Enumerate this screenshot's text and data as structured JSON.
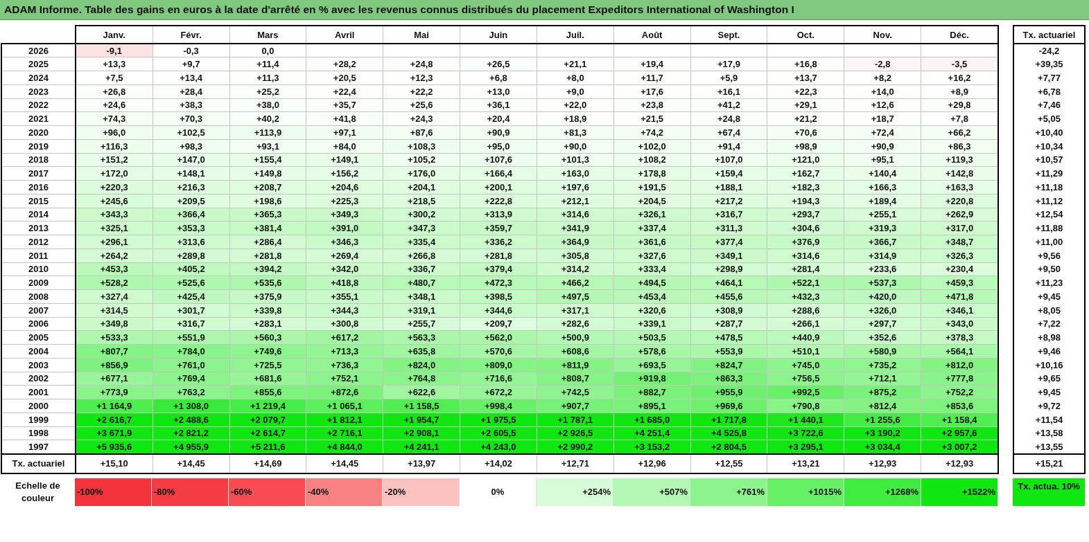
{
  "title": "ADAM Informe. Table des gains en euros à la date d'arrêté en % avec les revenus connus distribués du placement Expeditors International of Washington I",
  "columns": [
    "Janv.",
    "Févr.",
    "Mars",
    "Avril",
    "Mai",
    "Juin",
    "Juil.",
    "Août",
    "Sept.",
    "Oct.",
    "Nov.",
    "Déc."
  ],
  "rate_header": "Tx. actuariel",
  "rows": [
    {
      "year": "2026",
      "cells": [
        "-9,1",
        "-0,3",
        "0,0"
      ],
      "rate": "-24,2"
    },
    {
      "year": "2025",
      "cells": [
        "+13,3",
        "+9,7",
        "+11,4",
        "+28,2",
        "+24,8",
        "+26,5",
        "+21,1",
        "+19,4",
        "+17,9",
        "+16,8",
        "-2,8",
        "-3,5"
      ],
      "rate": "+39,35"
    },
    {
      "year": "2024",
      "cells": [
        "+7,5",
        "+13,4",
        "+11,3",
        "+20,5",
        "+12,3",
        "+6,8",
        "+8,0",
        "+11,7",
        "+5,9",
        "+13,7",
        "+8,2",
        "+16,2"
      ],
      "rate": "+7,77"
    },
    {
      "year": "2023",
      "cells": [
        "+26,8",
        "+28,4",
        "+25,2",
        "+22,4",
        "+22,2",
        "+13,0",
        "+9,0",
        "+17,6",
        "+16,1",
        "+22,3",
        "+14,0",
        "+8,9"
      ],
      "rate": "+6,78"
    },
    {
      "year": "2022",
      "cells": [
        "+24,6",
        "+38,3",
        "+38,0",
        "+35,7",
        "+25,6",
        "+36,1",
        "+22,0",
        "+23,8",
        "+41,2",
        "+29,1",
        "+12,6",
        "+29,8"
      ],
      "rate": "+7,46"
    },
    {
      "year": "2021",
      "cells": [
        "+74,3",
        "+70,3",
        "+40,2",
        "+41,8",
        "+24,3",
        "+20,4",
        "+18,9",
        "+21,5",
        "+24,8",
        "+21,2",
        "+18,7",
        "+7,8"
      ],
      "rate": "+5,05"
    },
    {
      "year": "2020",
      "cells": [
        "+96,0",
        "+102,5",
        "+113,9",
        "+97,1",
        "+87,6",
        "+90,9",
        "+81,3",
        "+74,2",
        "+67,4",
        "+70,6",
        "+72,4",
        "+66,2"
      ],
      "rate": "+10,40"
    },
    {
      "year": "2019",
      "cells": [
        "+116,3",
        "+98,3",
        "+93,1",
        "+84,0",
        "+108,3",
        "+95,0",
        "+90,0",
        "+102,0",
        "+91,4",
        "+98,9",
        "+90,9",
        "+86,3"
      ],
      "rate": "+10,34"
    },
    {
      "year": "2018",
      "cells": [
        "+151,2",
        "+147,0",
        "+155,4",
        "+149,1",
        "+105,2",
        "+107,6",
        "+101,3",
        "+108,2",
        "+107,0",
        "+121,0",
        "+95,1",
        "+119,3"
      ],
      "rate": "+10,57"
    },
    {
      "year": "2017",
      "cells": [
        "+172,0",
        "+148,1",
        "+149,8",
        "+156,2",
        "+176,0",
        "+166,4",
        "+163,0",
        "+178,8",
        "+159,4",
        "+162,7",
        "+140,4",
        "+142,8"
      ],
      "rate": "+11,29"
    },
    {
      "year": "2016",
      "cells": [
        "+220,3",
        "+216,3",
        "+208,7",
        "+204,6",
        "+204,1",
        "+200,1",
        "+197,6",
        "+191,5",
        "+188,1",
        "+182,3",
        "+166,3",
        "+163,3"
      ],
      "rate": "+11,18"
    },
    {
      "year": "2015",
      "cells": [
        "+245,6",
        "+209,5",
        "+198,6",
        "+225,3",
        "+218,5",
        "+222,8",
        "+212,1",
        "+204,5",
        "+217,2",
        "+194,3",
        "+189,4",
        "+220,8"
      ],
      "rate": "+11,12"
    },
    {
      "year": "2014",
      "cells": [
        "+343,3",
        "+366,4",
        "+365,3",
        "+349,3",
        "+300,2",
        "+313,9",
        "+314,6",
        "+326,1",
        "+316,7",
        "+293,7",
        "+255,1",
        "+262,9"
      ],
      "rate": "+12,54"
    },
    {
      "year": "2013",
      "cells": [
        "+325,1",
        "+353,3",
        "+381,4",
        "+391,0",
        "+347,3",
        "+359,7",
        "+341,9",
        "+337,4",
        "+311,3",
        "+304,6",
        "+319,3",
        "+317,0"
      ],
      "rate": "+11,88"
    },
    {
      "year": "2012",
      "cells": [
        "+296,1",
        "+313,6",
        "+286,4",
        "+346,3",
        "+335,4",
        "+336,2",
        "+364,9",
        "+361,6",
        "+377,4",
        "+376,9",
        "+366,7",
        "+348,7"
      ],
      "rate": "+11,00"
    },
    {
      "year": "2011",
      "cells": [
        "+264,2",
        "+289,8",
        "+281,8",
        "+269,4",
        "+266,8",
        "+281,8",
        "+305,8",
        "+327,6",
        "+349,1",
        "+314,6",
        "+314,9",
        "+326,3"
      ],
      "rate": "+9,56"
    },
    {
      "year": "2010",
      "cells": [
        "+453,3",
        "+405,2",
        "+394,2",
        "+342,0",
        "+336,7",
        "+379,4",
        "+314,2",
        "+333,4",
        "+298,9",
        "+281,4",
        "+233,6",
        "+230,4"
      ],
      "rate": "+9,50"
    },
    {
      "year": "2009",
      "cells": [
        "+528,2",
        "+525,6",
        "+535,6",
        "+418,8",
        "+480,7",
        "+472,3",
        "+466,2",
        "+494,5",
        "+464,1",
        "+522,1",
        "+537,3",
        "+459,3"
      ],
      "rate": "+11,23"
    },
    {
      "year": "2008",
      "cells": [
        "+327,4",
        "+425,4",
        "+375,9",
        "+355,1",
        "+348,1",
        "+398,5",
        "+497,5",
        "+453,4",
        "+455,6",
        "+432,3",
        "+420,0",
        "+471,8"
      ],
      "rate": "+9,45"
    },
    {
      "year": "2007",
      "cells": [
        "+314,5",
        "+301,7",
        "+339,8",
        "+344,3",
        "+319,1",
        "+344,6",
        "+317,1",
        "+320,6",
        "+308,9",
        "+288,6",
        "+326,0",
        "+346,1"
      ],
      "rate": "+8,05"
    },
    {
      "year": "2006",
      "cells": [
        "+349,8",
        "+316,7",
        "+283,1",
        "+300,8",
        "+255,7",
        "+209,7",
        "+282,6",
        "+339,1",
        "+287,7",
        "+266,1",
        "+297,7",
        "+343,0"
      ],
      "rate": "+7,22"
    },
    {
      "year": "2005",
      "cells": [
        "+533,3",
        "+551,9",
        "+560,3",
        "+617,2",
        "+563,3",
        "+562,0",
        "+500,9",
        "+503,5",
        "+478,5",
        "+440,9",
        "+352,6",
        "+378,3"
      ],
      "rate": "+8,98"
    },
    {
      "year": "2004",
      "cells": [
        "+807,7",
        "+784,0",
        "+749,6",
        "+713,3",
        "+635,8",
        "+570,6",
        "+608,6",
        "+578,6",
        "+553,9",
        "+510,1",
        "+580,9",
        "+564,1"
      ],
      "rate": "+9,46"
    },
    {
      "year": "2003",
      "cells": [
        "+856,9",
        "+761,0",
        "+725,5",
        "+736,3",
        "+824,0",
        "+809,0",
        "+811,9",
        "+693,5",
        "+824,7",
        "+745,0",
        "+735,2",
        "+812,0"
      ],
      "rate": "+10,16"
    },
    {
      "year": "2002",
      "cells": [
        "+677,1",
        "+769,4",
        "+681,6",
        "+752,1",
        "+764,8",
        "+716,6",
        "+808,7",
        "+919,8",
        "+863,3",
        "+756,5",
        "+712,1",
        "+777,8"
      ],
      "rate": "+9,65"
    },
    {
      "year": "2001",
      "cells": [
        "+773,9",
        "+763,2",
        "+855,6",
        "+872,6",
        "+622,6",
        "+672,2",
        "+742,5",
        "+882,7",
        "+955,9",
        "+992,5",
        "+875,2",
        "+752,2"
      ],
      "rate": "+9,45"
    },
    {
      "year": "2000",
      "cells": [
        "+1 164,9",
        "+1 308,0",
        "+1 219,4",
        "+1 065,1",
        "+1 158,5",
        "+998,4",
        "+907,7",
        "+895,1",
        "+969,6",
        "+790,8",
        "+812,4",
        "+853,6"
      ],
      "rate": "+9,72"
    },
    {
      "year": "1999",
      "cells": [
        "+2 616,7",
        "+2 488,6",
        "+2 079,7",
        "+1 812,1",
        "+1 954,7",
        "+1 975,5",
        "+1 787,1",
        "+1 685,0",
        "+1 717,8",
        "+1 440,1",
        "+1 255,6",
        "+1 158,4"
      ],
      "rate": "+11,54"
    },
    {
      "year": "1998",
      "cells": [
        "+3 671,9",
        "+2 821,2",
        "+2 614,7",
        "+2 716,1",
        "+2 908,1",
        "+2 605,5",
        "+2 926,5",
        "+4 251,4",
        "+4 525,8",
        "+3 722,6",
        "+3 190,2",
        "+2 957,6"
      ],
      "rate": "+13,58"
    },
    {
      "year": "1997",
      "cells": [
        "+5 935,6",
        "+4 955,9",
        "+5 211,6",
        "+4 844,0",
        "+4 241,1",
        "+4 243,0",
        "+2 990,2",
        "+3 153,2",
        "+2 804,5",
        "+3 295,1",
        "+3 034,4",
        "+3 007,2"
      ],
      "rate": "+13,55"
    }
  ],
  "footer": {
    "label": "Tx. actuariel",
    "cells": [
      "+15,10",
      "+14,45",
      "+14,69",
      "+14,45",
      "+13,97",
      "+14,02",
      "+12,71",
      "+12,96",
      "+12,55",
      "+13,21",
      "+12,93",
      "+12,93"
    ],
    "rate": "+15,21"
  },
  "legend": {
    "label": "Echelle de couleur",
    "items": [
      {
        "label": "-100%",
        "color": "#f4343c"
      },
      {
        "label": "-80%",
        "color": "#f53c44"
      },
      {
        "label": "-60%",
        "color": "#f64c52"
      },
      {
        "label": "-40%",
        "color": "#f88282"
      },
      {
        "label": "-20%",
        "color": "#fbc0c0"
      },
      {
        "label": "0%",
        "color": "#ffffff"
      },
      {
        "label": "+254%",
        "color": "#d8fcd8"
      },
      {
        "label": "+507%",
        "color": "#b2f8b2"
      },
      {
        "label": "+761%",
        "color": "#8cf48c"
      },
      {
        "label": "+1015%",
        "color": "#66f066"
      },
      {
        "label": "+1268%",
        "color": "#40ec40"
      },
      {
        "label": "+1522%",
        "color": "#10e610"
      }
    ],
    "benchmark": {
      "label": "Tx. actua. 10%",
      "color": "#10e610"
    }
  }
}
